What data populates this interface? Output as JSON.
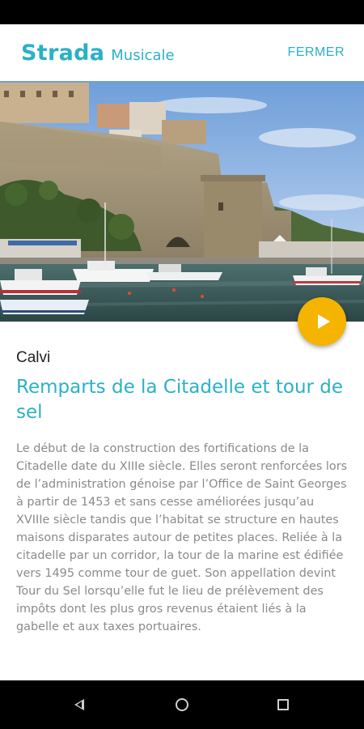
{
  "header": {
    "brand_main": "Strada",
    "brand_sub": "Musicale",
    "close_label": "FERMER"
  },
  "content": {
    "place": "Calvi",
    "title": "Remparts de la Citadelle et tour de sel",
    "description": "Le début de la construction des fortifications de la Citadelle date du XIIIe siècle. Elles seront renforcées lors de l’administration génoise par l’Office de Saint Georges à partir de 1453 et sans cesse améliorées jusqu’au XVIIIe siècle tandis que l’habitat se structure en hautes maisons disparates autour de petites places. Reliée à la citadelle par un corridor, la tour de la marine est édifiée vers 1495 comme tour de guet. Son appellation devint Tour du Sel lorsqu’elle fut le lieu de prélèvement des impôts dont les plus gros revenus étaient liés à la gabelle et aux taxes portuaires."
  },
  "colors": {
    "accent": "#2ab1c6",
    "play_button": "#f5b400"
  },
  "icons": {
    "play": "play-icon",
    "nav_back": "back-triangle-icon",
    "nav_home": "home-circle-icon",
    "nav_recent": "recent-apps-square-icon"
  }
}
